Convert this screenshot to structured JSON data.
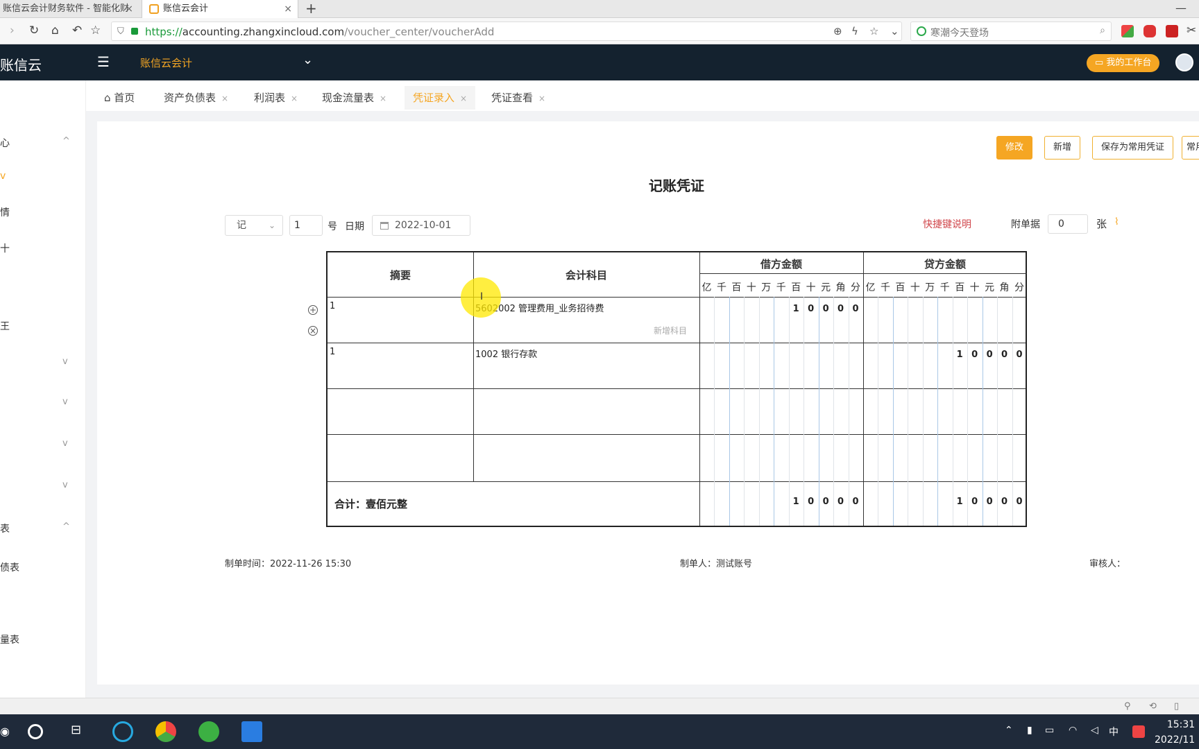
{
  "browser": {
    "tabs": [
      {
        "title": "账信云会计财务软件 - 智能化财"
      },
      {
        "title": "账信云会计"
      }
    ],
    "new_tab": "+",
    "minimize": "—",
    "url": {
      "scheme": "https://",
      "host": "accounting.zhangxincloud.com",
      "path": "/voucher_center/voucherAdd"
    },
    "search_placeholder": "寒潮今天登场"
  },
  "header": {
    "brand": "账信云",
    "org_name": "账信云会计",
    "workbench_label": "我的工作台"
  },
  "sidebar": {
    "items": [
      {
        "label": "心",
        "chevron": "^"
      },
      {
        "label": "v"
      },
      {
        "label": "情"
      },
      {
        "label": "十"
      },
      {
        "label": "王"
      },
      {
        "label": "",
        "chevron": "v"
      },
      {
        "label": "",
        "chevron": "v"
      },
      {
        "label": "",
        "chevron": "v"
      },
      {
        "label": "",
        "chevron": "v"
      },
      {
        "label": "表",
        "chevron": "^"
      },
      {
        "label": "债表"
      },
      {
        "label": "量表"
      }
    ]
  },
  "page_tabs": [
    {
      "label": "首页",
      "closable": false
    },
    {
      "label": "资产负债表",
      "closable": true
    },
    {
      "label": "利润表",
      "closable": true
    },
    {
      "label": "现金流量表",
      "closable": true
    },
    {
      "label": "凭证录入",
      "closable": true,
      "active": true
    },
    {
      "label": "凭证查看",
      "closable": true
    }
  ],
  "actions": {
    "edit": "修改",
    "new": "新增",
    "save_template": "保存为常用凭证",
    "common": "常用"
  },
  "voucher": {
    "title": "记账凭证",
    "type": "记",
    "number": "1",
    "number_suffix": "号",
    "date_label": "日期",
    "date": "2022-10-01",
    "shortcut_help": "快捷键说明",
    "attach_label": "附单据",
    "attach_count": "0",
    "attach_unit": "张",
    "columns": {
      "summary": "摘要",
      "account": "会计科目",
      "debit": "借方金额",
      "credit": "贷方金额"
    },
    "digit_headers": [
      "亿",
      "千",
      "百",
      "十",
      "万",
      "千",
      "百",
      "十",
      "元",
      "角",
      "分"
    ],
    "rows": [
      {
        "summary": "1",
        "account": "5602002 管理费用_业务招待费",
        "debit": [
          "",
          "",
          "",
          "",
          "",
          "",
          "1",
          "0",
          "0",
          "0",
          "0"
        ],
        "credit": [
          "",
          "",
          "",
          "",
          "",
          "",
          "",
          "",
          "",
          "",
          ""
        ],
        "add_account": "新增科目"
      },
      {
        "summary": "1",
        "account": "1002 银行存款",
        "debit": [
          "",
          "",
          "",
          "",
          "",
          "",
          "",
          "",
          "",
          "",
          ""
        ],
        "credit": [
          "",
          "",
          "",
          "",
          "",
          "",
          "1",
          "0",
          "0",
          "0",
          "0"
        ],
        "add_account": ""
      },
      {
        "summary": "",
        "account": "",
        "debit": [
          "",
          "",
          "",
          "",
          "",
          "",
          "",
          "",
          "",
          "",
          ""
        ],
        "credit": [
          "",
          "",
          "",
          "",
          "",
          "",
          "",
          "",
          "",
          "",
          ""
        ],
        "add_account": ""
      },
      {
        "summary": "",
        "account": "",
        "debit": [
          "",
          "",
          "",
          "",
          "",
          "",
          "",
          "",
          "",
          "",
          ""
        ],
        "credit": [
          "",
          "",
          "",
          "",
          "",
          "",
          "",
          "",
          "",
          "",
          ""
        ],
        "add_account": ""
      }
    ],
    "total_label": "合计：壹佰元整",
    "total_debit": [
      "",
      "",
      "",
      "",
      "",
      "",
      "1",
      "0",
      "0",
      "0",
      "0"
    ],
    "total_credit": [
      "",
      "",
      "",
      "",
      "",
      "",
      "1",
      "0",
      "0",
      "0",
      "0"
    ],
    "created_time": "制单时间：2022-11-26 15:30",
    "creator": "制单人：测试账号",
    "reviewer": "审核人："
  },
  "taskbar": {
    "ime": "中",
    "time": "15:31",
    "date": "2022/11"
  },
  "colors": {
    "accent": "#f5a623",
    "header_bg": "#14222f",
    "link_red": "#d0454a"
  }
}
